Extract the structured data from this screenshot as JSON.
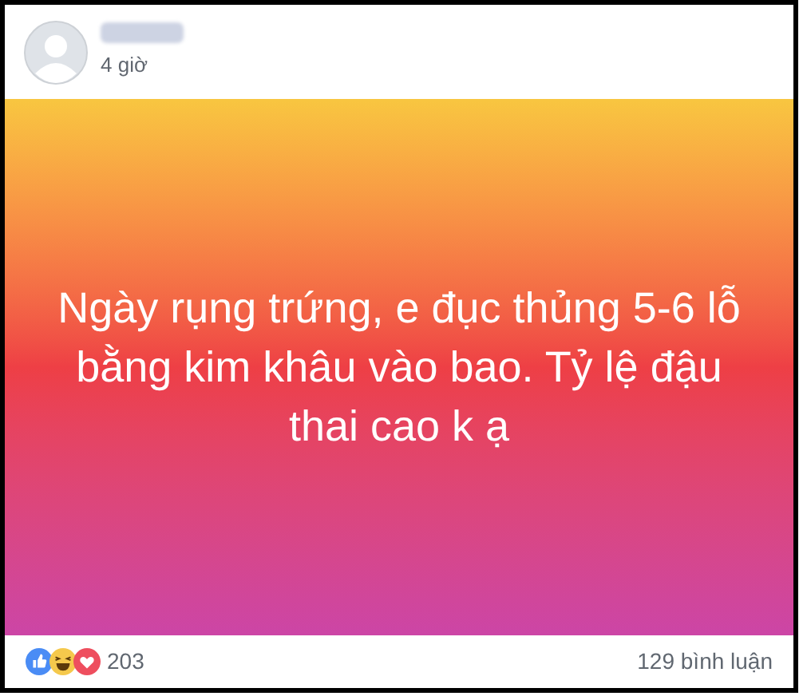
{
  "post": {
    "time": "4 giờ",
    "text": "Ngày rụng trứng, e đục thủng 5-6 lỗ bằng kim khâu vào bao. Tỷ lệ đậu thai cao k ạ"
  },
  "footer": {
    "reaction_count": "203",
    "comments": "129 bình luận"
  }
}
